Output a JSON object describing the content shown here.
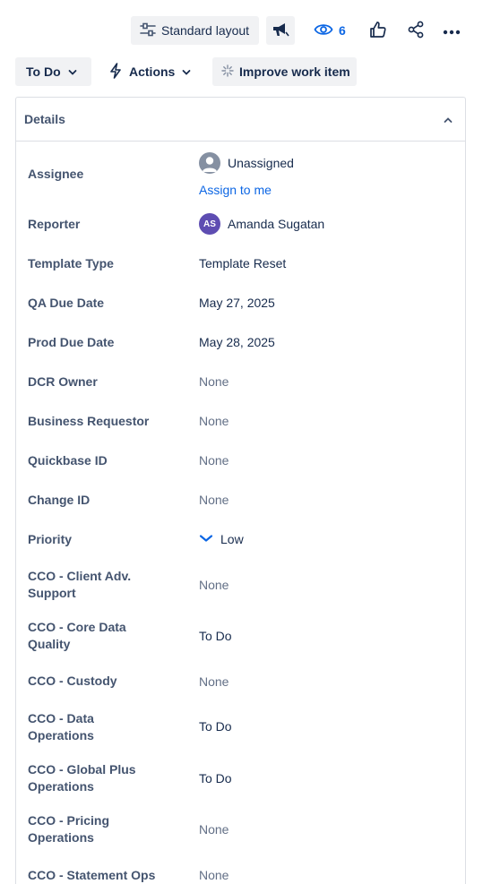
{
  "toolbar": {
    "layout_label": "Standard layout",
    "watch_count": "6"
  },
  "actionbar": {
    "status_label": "To Do",
    "actions_label": "Actions",
    "improve_label": "Improve work item"
  },
  "details": {
    "title": "Details",
    "fields": [
      {
        "label": "Assignee",
        "value": "Unassigned",
        "link": "Assign to me"
      },
      {
        "label": "Reporter",
        "value": "Amanda Sugatan",
        "initials": "AS"
      },
      {
        "label": "Template Type",
        "value": "Template Reset"
      },
      {
        "label": "QA Due Date",
        "value": "May 27, 2025"
      },
      {
        "label": "Prod Due Date",
        "value": "May 28, 2025"
      },
      {
        "label": "DCR Owner",
        "value": "None"
      },
      {
        "label": "Business Requestor",
        "value": "None"
      },
      {
        "label": "Quickbase ID",
        "value": "None"
      },
      {
        "label": "Change ID",
        "value": "None"
      },
      {
        "label": "Priority",
        "value": "Low"
      },
      {
        "label": "CCO - Client Adv. Support",
        "value": "None"
      },
      {
        "label": "CCO - Core Data Quality",
        "value": "To Do"
      },
      {
        "label": "CCO - Custody",
        "value": "None"
      },
      {
        "label": "CCO - Data Operations",
        "value": "To Do"
      },
      {
        "label": "CCO - Global Plus Operations",
        "value": "To Do"
      },
      {
        "label": "CCO - Pricing Operations",
        "value": "None"
      },
      {
        "label": "CCO - Statement Ops",
        "value": "None"
      }
    ]
  },
  "colors": {
    "link": "#0c66e4",
    "priority_low": "#0c66e4",
    "reporter_avatar": "#5e4db2"
  }
}
